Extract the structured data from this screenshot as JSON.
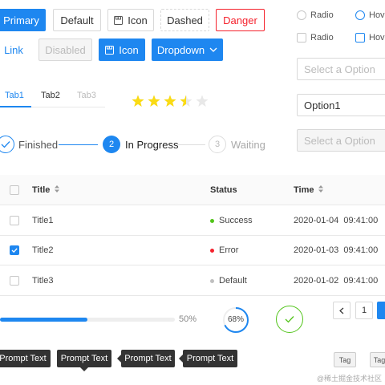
{
  "buttons": {
    "primary": "Primary",
    "default": "Default",
    "icon": "Icon",
    "dashed": "Dashed",
    "danger": "Danger",
    "link": "Link",
    "disabled": "Disabled",
    "icon_primary": "Icon",
    "dropdown": "Dropdown"
  },
  "radios": [
    {
      "label": "Radio"
    },
    {
      "label": "Hove"
    }
  ],
  "checkboxes": [
    {
      "label": "Radio"
    },
    {
      "label": "Hove"
    }
  ],
  "selects": {
    "first_placeholder": "Select a Option",
    "second_value": "Option1",
    "third_placeholder": "Select a Option"
  },
  "tabs": [
    {
      "label": "Tab1",
      "state": "active"
    },
    {
      "label": "Tab2",
      "state": "normal"
    },
    {
      "label": "Tab3",
      "state": "disabled"
    }
  ],
  "rating": {
    "value": 3.5,
    "max": 5
  },
  "steps": [
    {
      "label": "Finished",
      "status": "finished"
    },
    {
      "label": "In Progress",
      "number": "2",
      "status": "process"
    },
    {
      "label": "Waiting",
      "number": "3",
      "status": "wait"
    }
  ],
  "table": {
    "headers": {
      "title": "Title",
      "status": "Status",
      "time": "Time"
    },
    "rows": [
      {
        "title": "Title1",
        "status": "Success",
        "status_color": "#52c41a",
        "time": "2020-01-04  09:41:00",
        "checked": false
      },
      {
        "title": "Title2",
        "status": "Error",
        "status_color": "#f5222d",
        "time": "2020-01-03  09:41:00",
        "checked": true
      },
      {
        "title": "Title3",
        "status": "Default",
        "status_color": "#bfbfbf",
        "time": "2020-01-02  09:41:00",
        "checked": false
      }
    ]
  },
  "progress": {
    "value": 0.5,
    "label": "50%"
  },
  "circle_progress": {
    "value": 0.68,
    "label": "68%"
  },
  "pagination": {
    "current": "1"
  },
  "tooltips": [
    "Prompt Text",
    "Prompt Text",
    "Prompt Text",
    "Prompt Text"
  ],
  "tags": [
    "Tag",
    "Tag"
  ],
  "watermark": "@稀土掘金技术社区",
  "colors": {
    "primary": "#1e87f0",
    "success": "#52c41a",
    "error": "#f5222d",
    "star": "#fadb14"
  }
}
